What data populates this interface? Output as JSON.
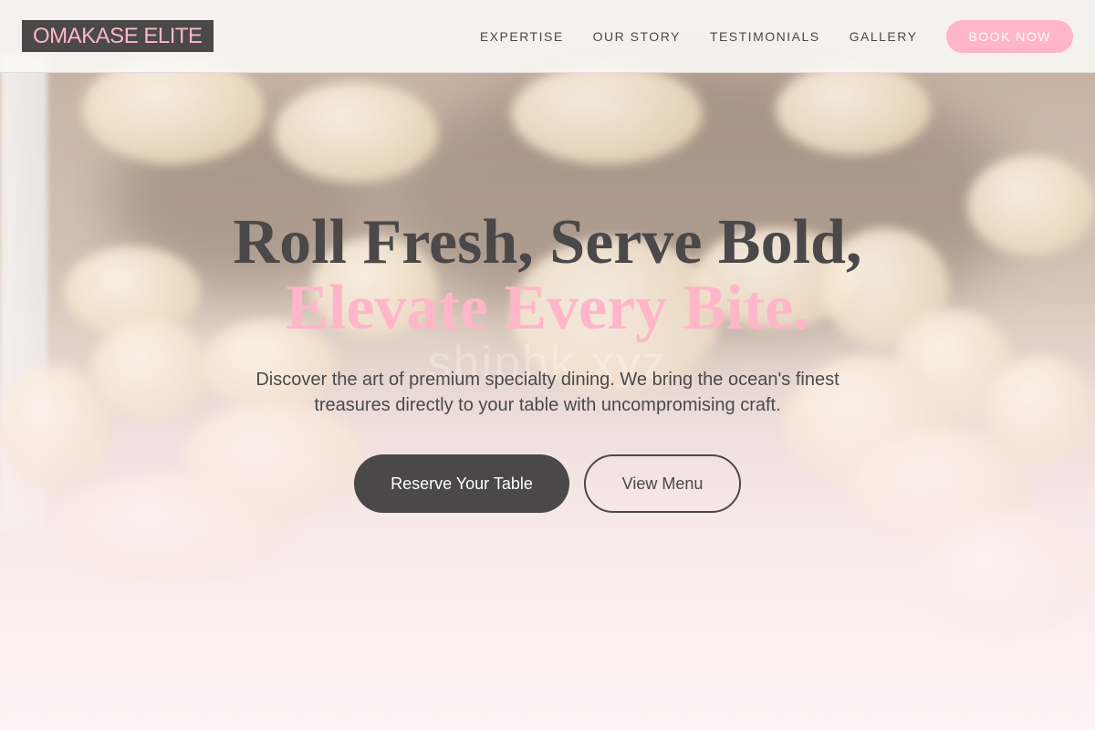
{
  "brand": {
    "logo_text": "OMAKASE ELITE"
  },
  "nav": {
    "items": [
      {
        "label": "EXPERTISE"
      },
      {
        "label": "OUR STORY"
      },
      {
        "label": "TESTIMONIALS"
      },
      {
        "label": "GALLERY"
      }
    ],
    "book_label": "BOOK NOW"
  },
  "hero": {
    "headline_line1": "Roll Fresh, Serve Bold,",
    "headline_line2": "Elevate Every Bite.",
    "subtitle": "Discover the art of premium specialty dining. We bring the ocean's finest treasures directly to your table with uncompromising craft.",
    "primary_cta": "Reserve Your Table",
    "secondary_cta": "View Menu",
    "watermark": "shipbk.xyz"
  },
  "colors": {
    "accent": "#ffb6c9",
    "dark": "#4a4848",
    "text": "#4a4a4a"
  }
}
